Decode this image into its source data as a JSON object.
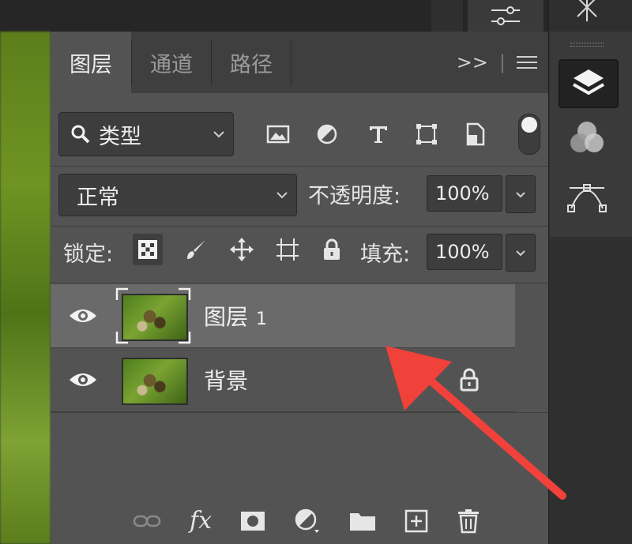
{
  "tabs": {
    "layers": "图层",
    "channels": "通道",
    "paths": "路径",
    "more": ">>"
  },
  "filter": {
    "kind_label": "类型"
  },
  "blend": {
    "mode": "正常",
    "opacity_label": "不透明度:",
    "opacity_value": "100%"
  },
  "lock": {
    "label": "锁定:",
    "fill_label": "填充:",
    "fill_value": "100%"
  },
  "layers": [
    {
      "name": "图层",
      "number": "1",
      "selected": true,
      "locked": false
    },
    {
      "name": "背景",
      "number": "",
      "selected": false,
      "locked": true
    }
  ],
  "bottom_tools": {
    "fx": "fx"
  },
  "icons": {
    "filter": [
      "image-filter-icon",
      "adjustment-filter-icon",
      "type-filter-icon",
      "shape-filter-icon",
      "smart-object-filter-icon"
    ],
    "lock": [
      "lock-transparent-pixels-icon",
      "lock-image-pixels-icon",
      "lock-position-icon",
      "lock-artboard-icon",
      "lock-all-icon"
    ],
    "bottom": [
      "link-layers-icon",
      "fx-icon",
      "add-mask-icon",
      "new-adjustment-icon",
      "new-group-icon",
      "new-layer-icon",
      "delete-layer-icon"
    ]
  },
  "colors": {
    "panel_bg": "#535353",
    "selected_row": "#6a6a6a",
    "arrow": "#f0413a"
  }
}
